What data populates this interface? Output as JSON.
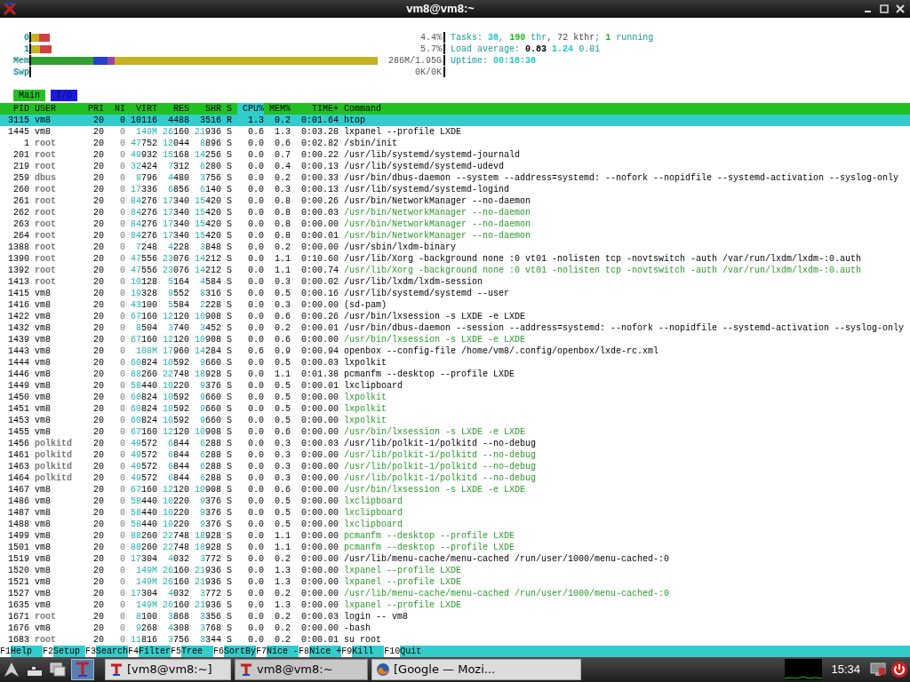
{
  "window": {
    "title": "vm8@vm8:~"
  },
  "meters": [
    {
      "label": "0",
      "value": "4.4%",
      "kind": "cpu",
      "level": 0.045
    },
    {
      "label": "1",
      "value": "5.7%",
      "kind": "cpu",
      "level": 0.05
    },
    {
      "label": "Mem",
      "value": "286M/1.95G",
      "kind": "memory",
      "level": 0.84
    },
    {
      "label": "Swp",
      "value": "0K/0K",
      "kind": "swap"
    }
  ],
  "status_lines": [
    [
      {
        "text": "Tasks: ",
        "kind": "label"
      },
      {
        "text": "38",
        "kind": "value"
      },
      {
        "text": ", ",
        "kind": "label"
      },
      {
        "text": "190",
        "kind": "accent"
      },
      {
        "text": " thr",
        "kind": "label"
      },
      {
        "text": ", 72 kthr",
        "kind": "muted"
      },
      {
        "text": "; ",
        "kind": "label"
      },
      {
        "text": "1",
        "kind": "accent"
      },
      {
        "text": " running",
        "kind": "label"
      }
    ],
    [
      {
        "text": "Load average: ",
        "kind": "label"
      },
      {
        "text": "0.83 ",
        "kind": "strong"
      },
      {
        "text": "1.24",
        "kind": "value"
      },
      {
        "text": " 0.81",
        "kind": "label"
      }
    ],
    [
      {
        "text": "Uptime: ",
        "kind": "label"
      },
      {
        "text": "00:18:38",
        "kind": "value"
      }
    ]
  ],
  "tabs": [
    {
      "label": "Main",
      "selected": true
    },
    {
      "label": "I/O",
      "selected": false
    }
  ],
  "columns": [
    {
      "label": "PID",
      "sorted": false
    },
    {
      "label": "USER",
      "sorted": false
    },
    {
      "label": "PRI",
      "sorted": false
    },
    {
      "label": "NI",
      "sorted": false
    },
    {
      "label": "VIRT",
      "sorted": false
    },
    {
      "label": "RES",
      "sorted": false
    },
    {
      "label": "SHR",
      "sorted": false
    },
    {
      "label": "S",
      "sorted": false
    },
    {
      "label": "CPU%",
      "sorted": true
    },
    {
      "label": "MEM%",
      "sorted": false
    },
    {
      "label": "TIME+",
      "sorted": false
    },
    {
      "label": "Command",
      "sorted": false
    }
  ],
  "rows": [
    {
      "pid": "3115",
      "user": "vm8",
      "pri": "20",
      "ni": "0",
      "virt": "10116",
      "res": "4488",
      "shr": "3516",
      "s": "R",
      "cpu": "1.3",
      "mem": "0.2",
      "time": "0:01.64",
      "command": "htop",
      "selected": true,
      "thread": false,
      "other_user": false
    },
    {
      "pid": "1445",
      "user": "vm8",
      "pri": "20",
      "ni": "0",
      "virt": "149M",
      "res": "26160",
      "shr": "21936",
      "s": "S",
      "cpu": "0.6",
      "mem": "1.3",
      "time": "0:03.28",
      "command": "lxpanel --profile LXDE",
      "selected": false,
      "thread": false,
      "other_user": false
    },
    {
      "pid": "1",
      "user": "root",
      "pri": "20",
      "ni": "0",
      "virt": "47752",
      "res": "12044",
      "shr": "8896",
      "s": "S",
      "cpu": "0.0",
      "mem": "0.6",
      "time": "0:02.82",
      "command": "/sbin/init",
      "selected": false,
      "thread": false,
      "other_user": true
    },
    {
      "pid": "201",
      "user": "root",
      "pri": "20",
      "ni": "0",
      "virt": "49932",
      "res": "15168",
      "shr": "14256",
      "s": "S",
      "cpu": "0.0",
      "mem": "0.7",
      "time": "0:00.22",
      "command": "/usr/lib/systemd/systemd-journald",
      "selected": false,
      "thread": false,
      "other_user": true
    },
    {
      "pid": "219",
      "user": "root",
      "pri": "20",
      "ni": "0",
      "virt": "32424",
      "res": "7312",
      "shr": "6280",
      "s": "S",
      "cpu": "0.0",
      "mem": "0.4",
      "time": "0:00.13",
      "command": "/usr/lib/systemd/systemd-udevd",
      "selected": false,
      "thread": false,
      "other_user": true
    },
    {
      "pid": "259",
      "user": "dbus",
      "pri": "20",
      "ni": "0",
      "virt": "8796",
      "res": "4480",
      "shr": "3756",
      "s": "S",
      "cpu": "0.0",
      "mem": "0.2",
      "time": "0:00.33",
      "command": "/usr/bin/dbus-daemon --system --address=systemd: --nofork --nopidfile --systemd-activation --syslog-only",
      "selected": false,
      "thread": false,
      "other_user": true
    },
    {
      "pid": "260",
      "user": "root",
      "pri": "20",
      "ni": "0",
      "virt": "17336",
      "res": "6856",
      "shr": "6140",
      "s": "S",
      "cpu": "0.0",
      "mem": "0.3",
      "time": "0:00.13",
      "command": "/usr/lib/systemd/systemd-logind",
      "selected": false,
      "thread": false,
      "other_user": true
    },
    {
      "pid": "261",
      "user": "root",
      "pri": "20",
      "ni": "0",
      "virt": "84276",
      "res": "17340",
      "shr": "15420",
      "s": "S",
      "cpu": "0.0",
      "mem": "0.8",
      "time": "0:00.26",
      "command": "/usr/bin/NetworkManager --no-daemon",
      "selected": false,
      "thread": false,
      "other_user": true
    },
    {
      "pid": "262",
      "user": "root",
      "pri": "20",
      "ni": "0",
      "virt": "84276",
      "res": "17340",
      "shr": "15420",
      "s": "S",
      "cpu": "0.0",
      "mem": "0.8",
      "time": "0:00.03",
      "command": "/usr/bin/NetworkManager --no-daemon",
      "selected": false,
      "thread": true,
      "other_user": true
    },
    {
      "pid": "263",
      "user": "root",
      "pri": "20",
      "ni": "0",
      "virt": "84276",
      "res": "17340",
      "shr": "15420",
      "s": "S",
      "cpu": "0.0",
      "mem": "0.8",
      "time": "0:00.00",
      "command": "/usr/bin/NetworkManager --no-daemon",
      "selected": false,
      "thread": true,
      "other_user": true
    },
    {
      "pid": "264",
      "user": "root",
      "pri": "20",
      "ni": "0",
      "virt": "84276",
      "res": "17340",
      "shr": "15420",
      "s": "S",
      "cpu": "0.0",
      "mem": "0.8",
      "time": "0:00.01",
      "command": "/usr/bin/NetworkManager --no-daemon",
      "selected": false,
      "thread": true,
      "other_user": true
    },
    {
      "pid": "1388",
      "user": "root",
      "pri": "20",
      "ni": "0",
      "virt": "7248",
      "res": "4228",
      "shr": "3848",
      "s": "S",
      "cpu": "0.0",
      "mem": "0.2",
      "time": "0:00.00",
      "command": "/usr/sbin/lxdm-binary",
      "selected": false,
      "thread": false,
      "other_user": true
    },
    {
      "pid": "1390",
      "user": "root",
      "pri": "20",
      "ni": "0",
      "virt": "47556",
      "res": "23076",
      "shr": "14212",
      "s": "S",
      "cpu": "0.0",
      "mem": "1.1",
      "time": "0:10.60",
      "command": "/usr/lib/Xorg -background none :0 vt01 -nolisten tcp -novtswitch -auth /var/run/lxdm/lxdm-:0.auth",
      "selected": false,
      "thread": false,
      "other_user": true
    },
    {
      "pid": "1392",
      "user": "root",
      "pri": "20",
      "ni": "0",
      "virt": "47556",
      "res": "23076",
      "shr": "14212",
      "s": "S",
      "cpu": "0.0",
      "mem": "1.1",
      "time": "0:00.74",
      "command": "/usr/lib/Xorg -background none :0 vt01 -nolisten tcp -novtswitch -auth /var/run/lxdm/lxdm-:0.auth",
      "selected": false,
      "thread": true,
      "other_user": true
    },
    {
      "pid": "1413",
      "user": "root",
      "pri": "20",
      "ni": "0",
      "virt": "10128",
      "res": "5164",
      "shr": "4584",
      "s": "S",
      "cpu": "0.0",
      "mem": "0.3",
      "time": "0:00.02",
      "command": "/usr/lib/lxdm/lxdm-session",
      "selected": false,
      "thread": false,
      "other_user": true
    },
    {
      "pid": "1415",
      "user": "vm8",
      "pri": "20",
      "ni": "0",
      "virt": "19328",
      "res": "9552",
      "shr": "8316",
      "s": "S",
      "cpu": "0.0",
      "mem": "0.5",
      "time": "0:00.16",
      "command": "/usr/lib/systemd/systemd --user",
      "selected": false,
      "thread": false,
      "other_user": false
    },
    {
      "pid": "1416",
      "user": "vm8",
      "pri": "20",
      "ni": "0",
      "virt": "43100",
      "res": "5584",
      "shr": "2228",
      "s": "S",
      "cpu": "0.0",
      "mem": "0.3",
      "time": "0:00.00",
      "command": "(sd-pam)",
      "selected": false,
      "thread": false,
      "other_user": false
    },
    {
      "pid": "1422",
      "user": "vm8",
      "pri": "20",
      "ni": "0",
      "virt": "67160",
      "res": "12120",
      "shr": "10908",
      "s": "S",
      "cpu": "0.0",
      "mem": "0.6",
      "time": "0:00.26",
      "command": "/usr/bin/lxsession -s LXDE -e LXDE",
      "selected": false,
      "thread": false,
      "other_user": false
    },
    {
      "pid": "1432",
      "user": "vm8",
      "pri": "20",
      "ni": "0",
      "virt": "8504",
      "res": "3740",
      "shr": "3452",
      "s": "S",
      "cpu": "0.0",
      "mem": "0.2",
      "time": "0:00.01",
      "command": "/usr/bin/dbus-daemon --session --address=systemd: --nofork --nopidfile --systemd-activation --syslog-only",
      "selected": false,
      "thread": false,
      "other_user": false
    },
    {
      "pid": "1439",
      "user": "vm8",
      "pri": "20",
      "ni": "0",
      "virt": "67160",
      "res": "12120",
      "shr": "10908",
      "s": "S",
      "cpu": "0.0",
      "mem": "0.6",
      "time": "0:00.00",
      "command": "/usr/bin/lxsession -s LXDE -e LXDE",
      "selected": false,
      "thread": true,
      "other_user": false
    },
    {
      "pid": "1443",
      "user": "vm8",
      "pri": "20",
      "ni": "0",
      "virt": "108M",
      "res": "17960",
      "shr": "14284",
      "s": "S",
      "cpu": "0.6",
      "mem": "0.9",
      "time": "0:00.94",
      "command": "openbox --config-file /home/vm8/.config/openbox/lxde-rc.xml",
      "selected": false,
      "thread": false,
      "other_user": false
    },
    {
      "pid": "1444",
      "user": "vm8",
      "pri": "20",
      "ni": "0",
      "virt": "60824",
      "res": "10592",
      "shr": "9660",
      "s": "S",
      "cpu": "0.0",
      "mem": "0.5",
      "time": "0:00.03",
      "command": "lxpolkit",
      "selected": false,
      "thread": false,
      "other_user": false
    },
    {
      "pid": "1446",
      "user": "vm8",
      "pri": "20",
      "ni": "0",
      "virt": "88260",
      "res": "22748",
      "shr": "18928",
      "s": "S",
      "cpu": "0.0",
      "mem": "1.1",
      "time": "0:01.38",
      "command": "pcmanfm --desktop --profile LXDE",
      "selected": false,
      "thread": false,
      "other_user": false
    },
    {
      "pid": "1449",
      "user": "vm8",
      "pri": "20",
      "ni": "0",
      "virt": "58440",
      "res": "10220",
      "shr": "9376",
      "s": "S",
      "cpu": "0.0",
      "mem": "0.5",
      "time": "0:00.01",
      "command": "lxclipboard",
      "selected": false,
      "thread": false,
      "other_user": false
    },
    {
      "pid": "1450",
      "user": "vm8",
      "pri": "20",
      "ni": "0",
      "virt": "60824",
      "res": "10592",
      "shr": "9660",
      "s": "S",
      "cpu": "0.0",
      "mem": "0.5",
      "time": "0:00.00",
      "command": "lxpolkit",
      "selected": false,
      "thread": true,
      "other_user": false
    },
    {
      "pid": "1451",
      "user": "vm8",
      "pri": "20",
      "ni": "0",
      "virt": "60824",
      "res": "10592",
      "shr": "9660",
      "s": "S",
      "cpu": "0.0",
      "mem": "0.5",
      "time": "0:00.00",
      "command": "lxpolkit",
      "selected": false,
      "thread": true,
      "other_user": false
    },
    {
      "pid": "1453",
      "user": "vm8",
      "pri": "20",
      "ni": "0",
      "virt": "60824",
      "res": "10592",
      "shr": "9660",
      "s": "S",
      "cpu": "0.0",
      "mem": "0.5",
      "time": "0:00.00",
      "command": "lxpolkit",
      "selected": false,
      "thread": true,
      "other_user": false
    },
    {
      "pid": "1455",
      "user": "vm8",
      "pri": "20",
      "ni": "0",
      "virt": "67160",
      "res": "12120",
      "shr": "10908",
      "s": "S",
      "cpu": "0.0",
      "mem": "0.6",
      "time": "0:00.00",
      "command": "/usr/bin/lxsession -s LXDE -e LXDE",
      "selected": false,
      "thread": true,
      "other_user": false
    },
    {
      "pid": "1456",
      "user": "polkitd",
      "pri": "20",
      "ni": "0",
      "virt": "49572",
      "res": "6844",
      "shr": "6288",
      "s": "S",
      "cpu": "0.0",
      "mem": "0.3",
      "time": "0:00.03",
      "command": "/usr/lib/polkit-1/polkitd --no-debug",
      "selected": false,
      "thread": false,
      "other_user": true
    },
    {
      "pid": "1461",
      "user": "polkitd",
      "pri": "20",
      "ni": "0",
      "virt": "49572",
      "res": "6844",
      "shr": "6288",
      "s": "S",
      "cpu": "0.0",
      "mem": "0.3",
      "time": "0:00.00",
      "command": "/usr/lib/polkit-1/polkitd --no-debug",
      "selected": false,
      "thread": true,
      "other_user": true
    },
    {
      "pid": "1463",
      "user": "polkitd",
      "pri": "20",
      "ni": "0",
      "virt": "49572",
      "res": "6844",
      "shr": "6288",
      "s": "S",
      "cpu": "0.0",
      "mem": "0.3",
      "time": "0:00.00",
      "command": "/usr/lib/polkit-1/polkitd --no-debug",
      "selected": false,
      "thread": true,
      "other_user": true
    },
    {
      "pid": "1464",
      "user": "polkitd",
      "pri": "20",
      "ni": "0",
      "virt": "49572",
      "res": "6844",
      "shr": "6288",
      "s": "S",
      "cpu": "0.0",
      "mem": "0.3",
      "time": "0:00.00",
      "command": "/usr/lib/polkit-1/polkitd --no-debug",
      "selected": false,
      "thread": true,
      "other_user": true
    },
    {
      "pid": "1467",
      "user": "vm8",
      "pri": "20",
      "ni": "0",
      "virt": "67160",
      "res": "12120",
      "shr": "10908",
      "s": "S",
      "cpu": "0.0",
      "mem": "0.6",
      "time": "0:00.00",
      "command": "/usr/bin/lxsession -s LXDE -e LXDE",
      "selected": false,
      "thread": true,
      "other_user": false
    },
    {
      "pid": "1486",
      "user": "vm8",
      "pri": "20",
      "ni": "0",
      "virt": "58440",
      "res": "10220",
      "shr": "9376",
      "s": "S",
      "cpu": "0.0",
      "mem": "0.5",
      "time": "0:00.00",
      "command": "lxclipboard",
      "selected": false,
      "thread": true,
      "other_user": false
    },
    {
      "pid": "1487",
      "user": "vm8",
      "pri": "20",
      "ni": "0",
      "virt": "58440",
      "res": "10220",
      "shr": "9376",
      "s": "S",
      "cpu": "0.0",
      "mem": "0.5",
      "time": "0:00.00",
      "command": "lxclipboard",
      "selected": false,
      "thread": true,
      "other_user": false
    },
    {
      "pid": "1488",
      "user": "vm8",
      "pri": "20",
      "ni": "0",
      "virt": "58440",
      "res": "10220",
      "shr": "9376",
      "s": "S",
      "cpu": "0.0",
      "mem": "0.5",
      "time": "0:00.00",
      "command": "lxclipboard",
      "selected": false,
      "thread": true,
      "other_user": false
    },
    {
      "pid": "1499",
      "user": "vm8",
      "pri": "20",
      "ni": "0",
      "virt": "88260",
      "res": "22748",
      "shr": "18928",
      "s": "S",
      "cpu": "0.0",
      "mem": "1.1",
      "time": "0:00.00",
      "command": "pcmanfm --desktop --profile LXDE",
      "selected": false,
      "thread": true,
      "other_user": false
    },
    {
      "pid": "1501",
      "user": "vm8",
      "pri": "20",
      "ni": "0",
      "virt": "88260",
      "res": "22748",
      "shr": "18928",
      "s": "S",
      "cpu": "0.0",
      "mem": "1.1",
      "time": "0:00.00",
      "command": "pcmanfm --desktop --profile LXDE",
      "selected": false,
      "thread": true,
      "other_user": false
    },
    {
      "pid": "1519",
      "user": "vm8",
      "pri": "20",
      "ni": "0",
      "virt": "17304",
      "res": "4032",
      "shr": "3772",
      "s": "S",
      "cpu": "0.0",
      "mem": "0.2",
      "time": "0:00.00",
      "command": "/usr/lib/menu-cache/menu-cached /run/user/1000/menu-cached-:0",
      "selected": false,
      "thread": false,
      "other_user": false
    },
    {
      "pid": "1520",
      "user": "vm8",
      "pri": "20",
      "ni": "0",
      "virt": "149M",
      "res": "26160",
      "shr": "21936",
      "s": "S",
      "cpu": "0.0",
      "mem": "1.3",
      "time": "0:00.00",
      "command": "lxpanel --profile LXDE",
      "selected": false,
      "thread": true,
      "other_user": false
    },
    {
      "pid": "1521",
      "user": "vm8",
      "pri": "20",
      "ni": "0",
      "virt": "149M",
      "res": "26160",
      "shr": "21936",
      "s": "S",
      "cpu": "0.0",
      "mem": "1.3",
      "time": "0:00.00",
      "command": "lxpanel --profile LXDE",
      "selected": false,
      "thread": true,
      "other_user": false
    },
    {
      "pid": "1527",
      "user": "vm8",
      "pri": "20",
      "ni": "0",
      "virt": "17304",
      "res": "4032",
      "shr": "3772",
      "s": "S",
      "cpu": "0.0",
      "mem": "0.2",
      "time": "0:00.00",
      "command": "/usr/lib/menu-cache/menu-cached /run/user/1000/menu-cached-:0",
      "selected": false,
      "thread": true,
      "other_user": false
    },
    {
      "pid": "1635",
      "user": "vm8",
      "pri": "20",
      "ni": "0",
      "virt": "149M",
      "res": "26160",
      "shr": "21936",
      "s": "S",
      "cpu": "0.0",
      "mem": "1.3",
      "time": "0:00.00",
      "command": "lxpanel --profile LXDE",
      "selected": false,
      "thread": true,
      "other_user": false
    },
    {
      "pid": "1671",
      "user": "root",
      "pri": "20",
      "ni": "0",
      "virt": "8100",
      "res": "3868",
      "shr": "3356",
      "s": "S",
      "cpu": "0.0",
      "mem": "0.2",
      "time": "0:00.03",
      "command": "login -- vm8",
      "selected": false,
      "thread": false,
      "other_user": true
    },
    {
      "pid": "1676",
      "user": "vm8",
      "pri": "20",
      "ni": "0",
      "virt": "9268",
      "res": "4308",
      "shr": "3768",
      "s": "S",
      "cpu": "0.0",
      "mem": "0.2",
      "time": "0:00.00",
      "command": "-bash",
      "selected": false,
      "thread": false,
      "other_user": false
    },
    {
      "pid": "1683",
      "user": "root",
      "pri": "20",
      "ni": "0",
      "virt": "11816",
      "res": "3756",
      "shr": "3344",
      "s": "S",
      "cpu": "0.0",
      "mem": "0.2",
      "time": "0:00.01",
      "command": "su root",
      "selected": false,
      "thread": false,
      "other_user": true
    }
  ],
  "function_keys": [
    {
      "key": "F1",
      "label": "Help"
    },
    {
      "key": "F2",
      "label": "Setup"
    },
    {
      "key": "F3",
      "label": "Search"
    },
    {
      "key": "F4",
      "label": "Filter"
    },
    {
      "key": "F5",
      "label": "Tree"
    },
    {
      "key": "F6",
      "label": "SortBy"
    },
    {
      "key": "F7",
      "label": "Nice -"
    },
    {
      "key": "F8",
      "label": "Nice +"
    },
    {
      "key": "F9",
      "label": "Kill"
    },
    {
      "key": "F10",
      "label": "Quit"
    }
  ],
  "taskbar": {
    "tasks": [
      {
        "label": "[vm8@vm8:~]",
        "selected": false
      },
      {
        "label": "vm8@vm8:~",
        "selected": true
      },
      {
        "label": "[Google — Mozi...",
        "selected": false,
        "kind": "browser"
      }
    ],
    "clock": "15:34"
  }
}
